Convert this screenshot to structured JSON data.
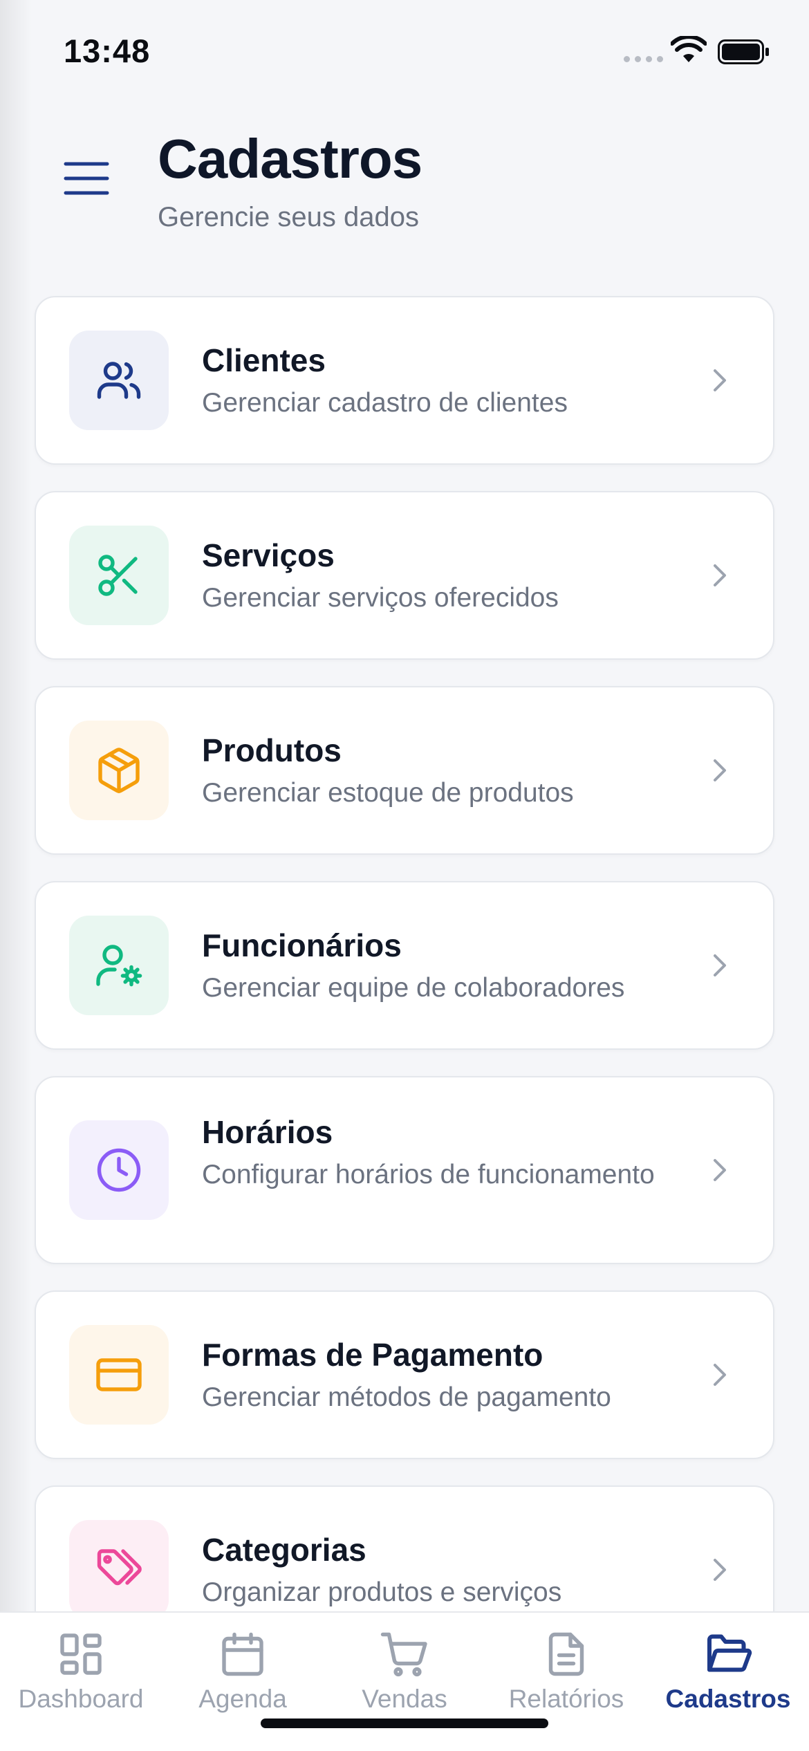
{
  "status_bar": {
    "time": "13:48"
  },
  "header": {
    "title": "Cadastros",
    "subtitle": "Gerencie seus dados"
  },
  "items": [
    {
      "title": "Clientes",
      "description": "Gerenciar cadastro de clientes",
      "icon": "users-icon",
      "accent": "#1e3a8a",
      "tile_bg": "#eef0f8"
    },
    {
      "title": "Serviços",
      "description": "Gerenciar serviços oferecidos",
      "icon": "scissors-icon",
      "accent": "#10b981",
      "tile_bg": "#e9f7f1"
    },
    {
      "title": "Produtos",
      "description": "Gerenciar estoque de produtos",
      "icon": "package-icon",
      "accent": "#f59e0b",
      "tile_bg": "#fef6ea"
    },
    {
      "title": "Funcionários",
      "description": "Gerenciar equipe de colaboradores",
      "icon": "user-cog-icon",
      "accent": "#10b981",
      "tile_bg": "#e9f7f1"
    },
    {
      "title": "Horários",
      "description": "Configurar horários de funcionamento",
      "icon": "clock-icon",
      "accent": "#8b5cf6",
      "tile_bg": "#f3f0fd"
    },
    {
      "title": "Formas de Pagamento",
      "description": "Gerenciar métodos de pagamento",
      "icon": "credit-card-icon",
      "accent": "#f59e0b",
      "tile_bg": "#fef6ea"
    },
    {
      "title": "Categorias",
      "description": "Organizar produtos e serviços",
      "icon": "tags-icon",
      "accent": "#ec4899",
      "tile_bg": "#fdeef5"
    }
  ],
  "tab_bar": {
    "tabs": [
      {
        "label": "Dashboard",
        "icon": "dashboard-icon"
      },
      {
        "label": "Agenda",
        "icon": "calendar-icon"
      },
      {
        "label": "Vendas",
        "icon": "cart-icon"
      },
      {
        "label": "Relatórios",
        "icon": "report-icon"
      },
      {
        "label": "Cadastros",
        "icon": "folder-open-icon"
      }
    ],
    "active": "Cadastros",
    "active_color": "#1e3a8a",
    "inactive_color": "#9ca3af"
  }
}
